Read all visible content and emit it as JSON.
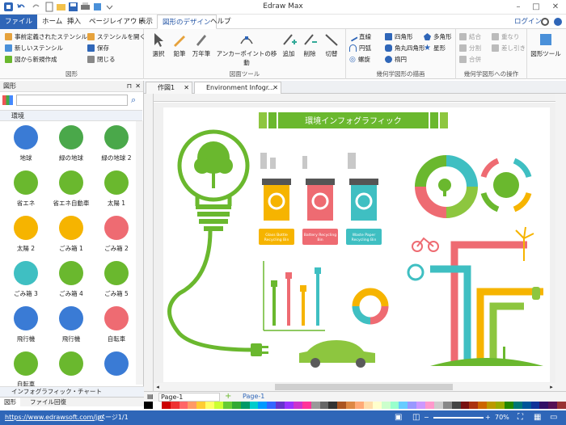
{
  "window": {
    "title": "Edraw Max",
    "login": "ログイン"
  },
  "menu": {
    "file": "ファイル",
    "tabs": [
      "ホーム",
      "挿入",
      "ページレイアウト",
      "表示",
      "図形のデザイン",
      "ヘルプ"
    ]
  },
  "ribbon": {
    "g1": {
      "items": [
        "事前定義されたステンシル",
        "新しいステンシル",
        "図から新規作成",
        "ステンシルを開く",
        "保存",
        "閉じる"
      ],
      "label": "図形"
    },
    "g2": {
      "buttons": [
        "選択",
        "鉛筆",
        "万年筆",
        "アンカーポイントの移動",
        "追加",
        "削除",
        "切替"
      ],
      "label": "図面ツール"
    },
    "g3": {
      "items": [
        "直線",
        "四角形",
        "多角形",
        "円弧",
        "角丸四角形",
        "星形",
        "螺旋",
        "楕円"
      ],
      "label": "幾何学図形の描画"
    },
    "g4": {
      "items": [
        "結合",
        "重なり",
        "分割",
        "差し引き",
        "合併"
      ],
      "label": "幾何学図形への操作"
    },
    "g5": {
      "label": "図形ツール"
    }
  },
  "sidebar": {
    "title": "図形",
    "category": "環境",
    "shapes": [
      "地球",
      "緑の地球",
      "緑の地球 2",
      "省エネ",
      "省エネ自動車",
      "太陽 1",
      "太陽 2",
      "ごみ箱 1",
      "ごみ箱 2",
      "ごみ箱 3",
      "ごみ箱 4",
      "ごみ箱 5",
      "飛行機",
      "飛行機",
      "自転車",
      "自転車",
      "",
      ""
    ],
    "category2": "インフォグラフィック・チャート",
    "tabs": [
      "図形",
      "ファイル回復"
    ]
  },
  "doc_tabs": [
    "作図1",
    "Environment Infogr..."
  ],
  "infographic": {
    "title": "環境インフォグラフィック",
    "bins": [
      {
        "label": "Glass Bottle Recycling Bin",
        "color": "#f6b400"
      },
      {
        "label": "Battery Recycling Bin",
        "color": "#ee6b72"
      },
      {
        "label": "Waste Paper Recycling Bin",
        "color": "#3fbfc2"
      }
    ]
  },
  "pagebar": {
    "page_select": "Page-1",
    "page_tab": "Page-1"
  },
  "status": {
    "url": "https://www.edrawsoft.com/jp/",
    "page": "ページ1/1",
    "zoom": "70%"
  },
  "colors": {
    "accent": "#2f66b8",
    "green": "#6ab82e"
  }
}
